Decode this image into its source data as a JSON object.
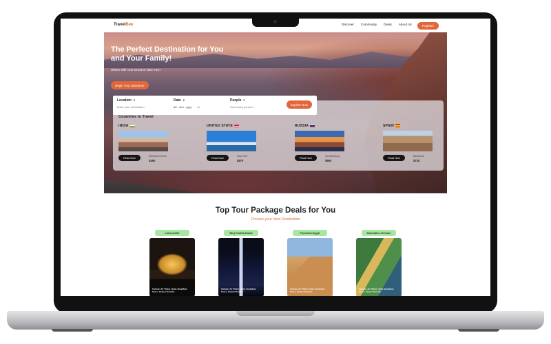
{
  "nav": {
    "logo_main": "Travel",
    "logo_accent": "Bee",
    "links": [
      "Discover",
      "Community",
      "Deals",
      "About Us"
    ],
    "register_label": "Register"
  },
  "hero": {
    "title": "The Perfect Destination for You and Your Family!",
    "subtitle": "Where Will Your Dreams Take You?",
    "cta_label": "Begin Your Adventure"
  },
  "search": {
    "location_label": "Location",
    "location_placeholder": "Enter your Destination",
    "date_label": "Date",
    "date_placeholder": "dd - mm - yyyy",
    "people_label": "People",
    "people_placeholder": "How many person?",
    "explore_label": "Explore Now"
  },
  "countries": {
    "title": "Countries to Travel",
    "items": [
      {
        "name": "INDIA",
        "place": "Mumbai Central",
        "price": "$460",
        "button": "Read Now"
      },
      {
        "name": "UNITED STATE",
        "place": "New York",
        "price": "$870",
        "button": "Read Now"
      },
      {
        "name": "RUSSIA",
        "place": "Schattenburg",
        "price": "$660",
        "button": "Read Now"
      },
      {
        "name": "SPAIN",
        "place": "Barcelona",
        "price": "$730",
        "button": "Read Now"
      }
    ]
  },
  "tours": {
    "title": "Top Tour Package Deals for You",
    "subtitle": "Choose your Next Destination",
    "items": [
      {
        "tag": "Lotus-Delhi",
        "note": "Include: Air Ticket, Hotel, Breakfast, Tours, Airport Transfer"
      },
      {
        "tag": "Burj Khalifa-Dubai",
        "note": "Include: Air Ticket, Hotel, Breakfast, Tours, Airport Transfer"
      },
      {
        "tag": "Pyramids-Egypt",
        "note": "Include: Air Ticket, Hotel, Breakfast, Tours, Airport Transfer"
      },
      {
        "tag": "Mountains-Vietnam",
        "note": "Include: Air Ticket, Hotel, Breakfast, Tours, Airport Transfer"
      }
    ]
  },
  "colors": {
    "accent": "#e0673d",
    "tag_green": "#a8e6a1"
  }
}
